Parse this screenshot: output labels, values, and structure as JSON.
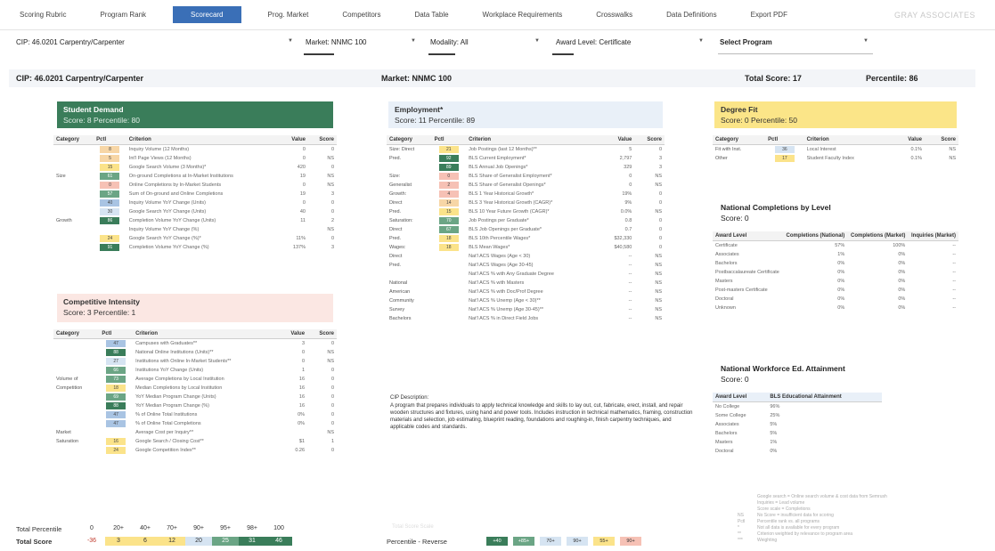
{
  "nav": {
    "items": [
      "Scoring Rubric",
      "Program Rank",
      "Scorecard",
      "Prog. Market",
      "Competitors",
      "Data Table",
      "Workplace Requirements",
      "Crosswalks",
      "Data Definitions"
    ],
    "active": "Scorecard",
    "export": "Export PDF",
    "brand": "GRAY ASSOCIATES"
  },
  "filters": {
    "cip": "CIP: 46.0201 Carpentry/Carpenter",
    "market": "Market: NNMC 100",
    "modality": "Modality: All",
    "award": "Award Level: Certificate",
    "program": "Select Program",
    "caret": "▼"
  },
  "summary": {
    "cip": "CIP: 46.0201 Carpentry/Carpenter",
    "market": "Market: NNMC 100",
    "total": "Total Score: 17",
    "percentile": "Percentile: 86"
  },
  "student_demand": {
    "title": "Student Demand",
    "subtitle": "Score: 8 Percentile: 80",
    "headers": [
      "Category",
      "Pctl",
      "Criterion",
      "Value",
      "Score"
    ],
    "rows": [
      {
        "cat": "",
        "pctl": "8",
        "crit": "Inquiry Volume (12 Months)",
        "val": "0",
        "score": "0"
      },
      {
        "cat": "",
        "pctl": "5",
        "crit": "Int'l Page Views (12 Months)",
        "val": "0",
        "score": "NS"
      },
      {
        "cat": "",
        "pctl": "15",
        "crit": "Google Search Volume (3 Months)*",
        "val": "420",
        "score": "0"
      },
      {
        "cat": "Size",
        "pctl": "61",
        "crit": "On-ground Completions at In-Market Institutions",
        "val": "19",
        "score": "NS"
      },
      {
        "cat": "",
        "pctl": "0",
        "crit": "Online Completions by In-Market Students",
        "val": "0",
        "score": "NS"
      },
      {
        "cat": "",
        "pctl": "57",
        "crit": "Sum of On-ground and Online Completions",
        "val": "19",
        "score": "3"
      },
      {
        "cat": "",
        "pctl": "40",
        "crit": "Inquiry Volume YoY Change (Units)",
        "val": "0",
        "score": "0"
      },
      {
        "cat": "",
        "pctl": "30",
        "crit": "Google Search YoY Change (Units)",
        "val": "40",
        "score": "0"
      },
      {
        "cat": "Growth",
        "pctl": "86",
        "crit": "Completion Volume YoY Change (Units)",
        "val": "11",
        "score": "2"
      },
      {
        "cat": "",
        "pctl": "",
        "crit": "Inquiry Volume YoY Change (%)",
        "val": "",
        "score": "NS"
      },
      {
        "cat": "",
        "pctl": "24",
        "crit": "Google Search YoY Change (%)*",
        "val": "11%",
        "score": "0"
      },
      {
        "cat": "",
        "pctl": "91",
        "crit": "Completion Volume YoY Change (%)",
        "val": "137%",
        "score": "3"
      }
    ]
  },
  "competitive": {
    "title": "Competitive Intensity",
    "subtitle": "Score: 3 Percentile: 1",
    "headers": [
      "Category",
      "Pctl",
      "Criterion",
      "Value",
      "Score"
    ],
    "rows": [
      {
        "cat": "",
        "pctl": "47",
        "crit": "Campuses with Graduates**",
        "val": "3",
        "score": "0"
      },
      {
        "cat": "",
        "pctl": "88",
        "crit": "National Online Institutions (Units)**",
        "val": "0",
        "score": "NS"
      },
      {
        "cat": "",
        "pctl": "27",
        "crit": "Institutions with Online In-Market Students**",
        "val": "0",
        "score": "NS"
      },
      {
        "cat": "",
        "pctl": "66",
        "crit": "Institutions YoY Change (Units)",
        "val": "1",
        "score": "0"
      },
      {
        "cat": "Volume of",
        "pctl": "73",
        "crit": "Average Completions by Local Institution",
        "val": "16",
        "score": "0"
      },
      {
        "cat": "Competition",
        "pctl": "18",
        "crit": "Median Completions by Local Institution",
        "val": "16",
        "score": "0"
      },
      {
        "cat": "",
        "pctl": "69",
        "crit": "YoY Median Program Change (Units)",
        "val": "16",
        "score": "0"
      },
      {
        "cat": "",
        "pctl": "88",
        "crit": "YoY Median Program Change (%)",
        "val": "16",
        "score": "0"
      },
      {
        "cat": "",
        "pctl": "47",
        "crit": "% of Online Total Institutions",
        "val": "0%",
        "score": "0"
      },
      {
        "cat": "",
        "pctl": "47",
        "crit": "% of Online Total Completions",
        "val": "0%",
        "score": "0"
      },
      {
        "cat": "Market",
        "pctl": "",
        "crit": "Average Cost per Inquiry**",
        "val": "",
        "score": "NS"
      },
      {
        "cat": "Saturation",
        "pctl": "16",
        "crit": "Google Search / Closing Cost**",
        "val": "$1",
        "score": "1"
      },
      {
        "cat": "",
        "pctl": "24",
        "crit": "Google Competition Index**",
        "val": "0.26",
        "score": "0"
      }
    ]
  },
  "employment": {
    "title": "Employment*",
    "subtitle": "Score: 11 Percentile: 89",
    "headers": [
      "Category",
      "Pctl",
      "Criterion",
      "Value",
      "Score"
    ],
    "rows": [
      {
        "cat": "Size: Direct",
        "pctl": "21",
        "crit": "Job Postings (last 12 Months)**",
        "val": "5",
        "score": "0"
      },
      {
        "cat": "Pred.",
        "pctl": "92",
        "crit": "BLS Current Employment*",
        "val": "2,797",
        "score": "3"
      },
      {
        "cat": "",
        "pctl": "89",
        "crit": "BLS Annual Job Openings*",
        "val": "329",
        "score": "3"
      },
      {
        "cat": "Size:",
        "pctl": "0",
        "crit": "BLS Share of Generalist Employment*",
        "val": "0",
        "score": "NS"
      },
      {
        "cat": "Generalist",
        "pctl": "2",
        "crit": "BLS Share of Generalist Openings*",
        "val": "0",
        "score": "NS"
      },
      {
        "cat": "Growth:",
        "pctl": "4",
        "crit": "BLS 1 Year Historical Growth*",
        "val": "19%",
        "score": "0"
      },
      {
        "cat": "Direct",
        "pctl": "14",
        "crit": "BLS 3 Year Historical Growth (CAGR)*",
        "val": "9%",
        "score": "0"
      },
      {
        "cat": "Pred.",
        "pctl": "15",
        "crit": "BLS 10 Year Future Growth (CAGR)*",
        "val": "0.0%",
        "score": "NS"
      },
      {
        "cat": "Saturation:",
        "pctl": "70",
        "crit": "Job Postings per Graduate*",
        "val": "0.8",
        "score": "0"
      },
      {
        "cat": "Direct",
        "pctl": "67",
        "crit": "BLS Job Openings per Graduate*",
        "val": "0.7",
        "score": "0"
      },
      {
        "cat": "Pred.",
        "pctl": "18",
        "crit": "BLS 10th Percentile Wages*",
        "val": "$32,330",
        "score": "0"
      },
      {
        "cat": "Wages:",
        "pctl": "18",
        "crit": "BLS Mean Wages*",
        "val": "$40,580",
        "score": "0"
      },
      {
        "cat": "Direct",
        "pctl": "",
        "crit": "Nat'l ACS Wages (Age < 30)",
        "val": "--",
        "score": "NS"
      },
      {
        "cat": "Pred.",
        "pctl": "",
        "crit": "Nat'l ACS Wages (Age 30-45)",
        "val": "--",
        "score": "NS"
      },
      {
        "cat": "",
        "pctl": "",
        "crit": "Nat'l ACS % with Any Graduate Degree",
        "val": "--",
        "score": "NS"
      },
      {
        "cat": "National",
        "pctl": "",
        "crit": "Nat'l ACS % with Masters",
        "val": "--",
        "score": "NS"
      },
      {
        "cat": "American",
        "pctl": "",
        "crit": "Nat'l ACS % with Doc/Prof Degree",
        "val": "--",
        "score": "NS"
      },
      {
        "cat": "Community",
        "pctl": "",
        "crit": "Nat'l ACS % Unemp (Age < 30)**",
        "val": "--",
        "score": "NS"
      },
      {
        "cat": "Survey",
        "pctl": "",
        "crit": "Nat'l ACS % Unemp (Age 30-45)**",
        "val": "--",
        "score": "NS"
      },
      {
        "cat": "Bachelors",
        "pctl": "",
        "crit": "Nat'l ACS % in Direct Field Jobs",
        "val": "--",
        "score": "NS"
      }
    ]
  },
  "description": {
    "label": "CIP Description:",
    "text": "A program that prepares individuals to apply technical knowledge and skills to lay out, cut, fabricate, erect, install, and repair wooden structures and fixtures, using hand and power tools. Includes instruction in technical mathematics, framing, construction materials and selection, job estimating, blueprint reading, foundations and roughing-in, finish carpentry techniques, and applicable codes and standards."
  },
  "degree_fit": {
    "title": "Degree Fit",
    "subtitle": "Score: 0 Percentile: 50",
    "headers": [
      "Category",
      "Pctl",
      "Criterion",
      "Value",
      "Score"
    ],
    "rows": [
      {
        "cat": "Fit with Inst.",
        "pctl": "36",
        "crit": "Local Interest",
        "val": "0.1%",
        "score": "NS"
      },
      {
        "cat": "Other",
        "pctl": "17",
        "crit": "Student Faculty Index",
        "val": "0.1%",
        "score": "NS"
      }
    ]
  },
  "completions": {
    "title": "National Completions by Level",
    "subtitle": "Score: 0",
    "headers": [
      "Award Level",
      "Completions (National)",
      "Completions (Market)",
      "Inquiries (Market)"
    ],
    "rows": [
      {
        "level": "Certificate",
        "nat": "57%",
        "mkt": "100%",
        "inq": "--"
      },
      {
        "level": "Associates",
        "nat": "1%",
        "mkt": "0%",
        "inq": "--"
      },
      {
        "level": "Bachelors",
        "nat": "0%",
        "mkt": "0%",
        "inq": "--"
      },
      {
        "level": "Postbaccalaureate Certificate",
        "nat": "0%",
        "mkt": "0%",
        "inq": "--"
      },
      {
        "level": "Masters",
        "nat": "0%",
        "mkt": "0%",
        "inq": "--"
      },
      {
        "level": "Post-masters Certificate",
        "nat": "0%",
        "mkt": "0%",
        "inq": "--"
      },
      {
        "level": "Doctoral",
        "nat": "0%",
        "mkt": "0%",
        "inq": "--"
      },
      {
        "level": "Unknown",
        "nat": "0%",
        "mkt": "0%",
        "inq": "--"
      }
    ]
  },
  "workforce": {
    "title": "National Workforce Ed. Attainment",
    "subtitle": "Score: 0",
    "headers": [
      "Award Level",
      "BLS Educational Attainment"
    ],
    "rows": [
      {
        "level": "No College",
        "val": "96%"
      },
      {
        "level": "Some College",
        "val": "25%"
      },
      {
        "level": "Associates",
        "val": "5%"
      },
      {
        "level": "Bachelors",
        "val": "5%"
      },
      {
        "level": "Masters",
        "val": "1%"
      },
      {
        "level": "Doctoral",
        "val": "0%"
      }
    ]
  },
  "scale": {
    "percentile_label": "Total Percentile",
    "percentiles": [
      "0",
      "20+",
      "40+",
      "70+",
      "90+",
      "95+",
      "98+",
      "100"
    ],
    "score_label": "Total Score",
    "scores": [
      "-36",
      "3",
      "6",
      "12",
      "20",
      "25",
      "31",
      "46"
    ],
    "score_colors": [
      "#f6c1b5",
      "#fbe38a",
      "#fbe38a",
      "#fbe38a",
      "#d6e4f2",
      "#6ba585",
      "#3a7d5a",
      "#3a7d5a"
    ],
    "faded_label": "Total Score Scale",
    "pctl_label": "Percentile - Reverse",
    "pctl_cells": [
      "+40",
      "+85+",
      "70+",
      "90+",
      "55+",
      "90+"
    ],
    "pctl_colors": [
      "#3a7d5a",
      "#6ba585",
      "#d6e4f2",
      "#d6e4f2",
      "#fbe38a",
      "#f6c1b5"
    ]
  },
  "legend": [
    {
      "k": "",
      "v": "Google search = Online search volume & cost data from Semrush"
    },
    {
      "k": "",
      "v": "Inquiries = Lead volume"
    },
    {
      "k": "",
      "v": "Score scale = Completions"
    },
    {
      "k": "NS",
      "v": "No Score = insufficient data for scoring"
    },
    {
      "k": "Pctl",
      "v": "Percentile rank vs. all programs"
    },
    {
      "k": "*",
      "v": "Not all data is available for every program"
    },
    {
      "k": "**",
      "v": "Criterion weighted by relevance to program area"
    },
    {
      "k": "***",
      "v": "Weighting"
    }
  ]
}
